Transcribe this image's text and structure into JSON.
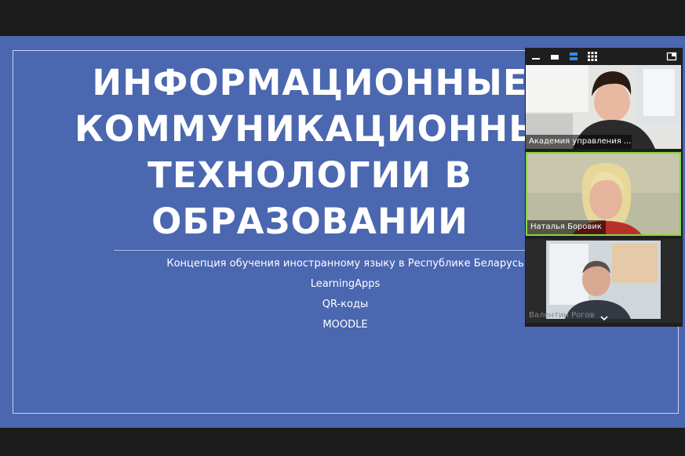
{
  "slide": {
    "title_lines": [
      "ИНФОРМАЦИОННЫЕ",
      "КОММУНИКАЦИОННЫЕ",
      "ТЕХНОЛОГИИ В",
      "ОБРАЗОВАНИИ"
    ],
    "subtitle_items": [
      "Концепция обучения иностранному языку в Республике Беларусь",
      "LearningApps",
      "QR-коды",
      "MOODLE"
    ]
  },
  "video_panel": {
    "toolbar_icons": [
      "minimize-icon",
      "window-icon",
      "speaker-view-icon",
      "gallery-view-icon",
      "exit-panel-icon"
    ],
    "participants": [
      {
        "name": "Академия управления ...",
        "active": false
      },
      {
        "name": "Наталья Боровик",
        "active": true
      },
      {
        "name": "Валентин Рогов",
        "active": false
      }
    ],
    "scroll_icon": "chevron-down-icon"
  },
  "colors": {
    "slide_bg": "#4a67b0",
    "active_border": "#8bd33f"
  }
}
